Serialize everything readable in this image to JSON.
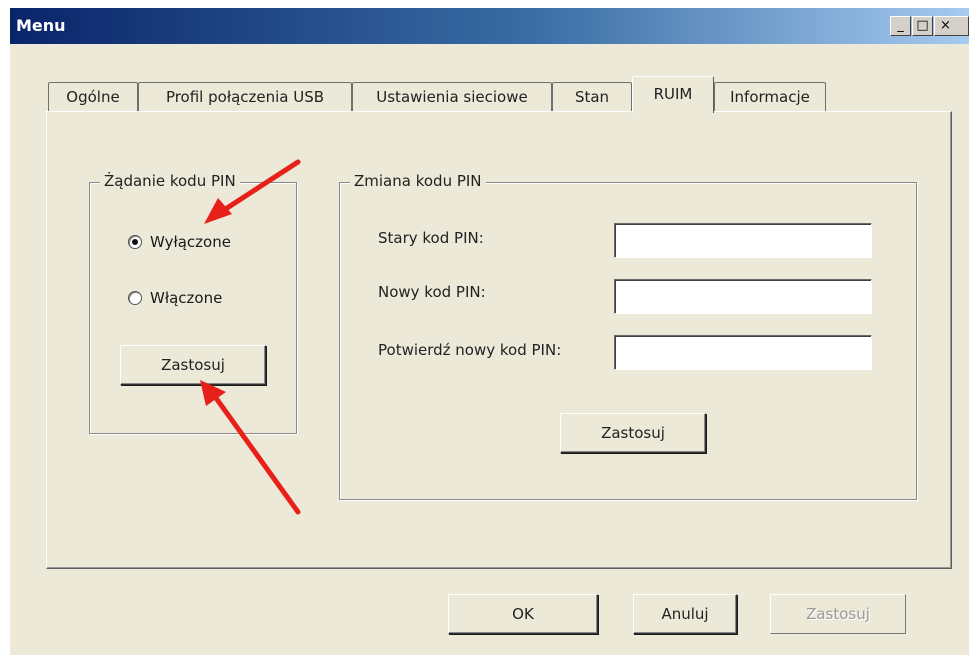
{
  "window": {
    "title": "Menu",
    "controls": {
      "minimize": "_",
      "maximize": "□",
      "close": "×"
    }
  },
  "tabs": [
    {
      "label": "Ogólne",
      "active": false
    },
    {
      "label": "Profil połączenia USB",
      "active": false
    },
    {
      "label": "Ustawienia sieciowe",
      "active": false
    },
    {
      "label": "Stan",
      "active": false
    },
    {
      "label": "RUIM",
      "active": true
    },
    {
      "label": "Informacje",
      "active": false
    }
  ],
  "pin_request": {
    "legend": "Żądanie kodu PIN",
    "options": [
      {
        "label": "Wyłączone",
        "checked": true
      },
      {
        "label": "Włączone",
        "checked": false
      }
    ],
    "apply_label": "Zastosuj"
  },
  "pin_change": {
    "legend": "Zmiana kodu PIN",
    "fields": [
      {
        "label": "Stary kod PIN:",
        "value": ""
      },
      {
        "label": "Nowy kod PIN:",
        "value": ""
      },
      {
        "label": "Potwierdź nowy kod PIN:",
        "value": ""
      }
    ],
    "apply_label": "Zastosuj"
  },
  "footer": {
    "ok_label": "OK",
    "cancel_label": "Anuluj",
    "apply_label": "Zastosuj",
    "apply_disabled": true
  },
  "annotations": {
    "arrow_color": "#e8201a"
  }
}
